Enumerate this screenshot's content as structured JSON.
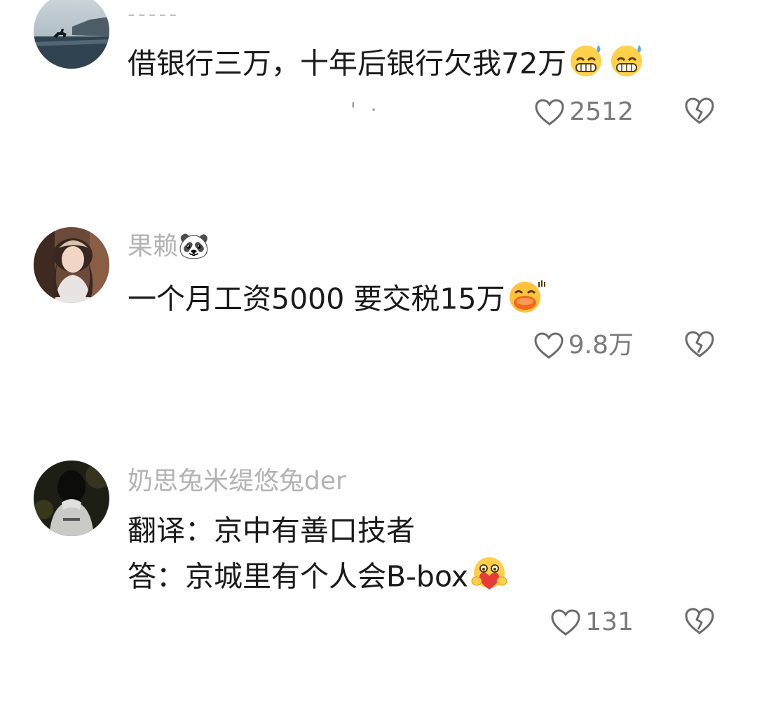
{
  "comments": [
    {
      "username": "-----",
      "avatar_icon": "avatar-horse-rider-beach",
      "lines": [
        "借银行三万，十年后银行欠我72万"
      ],
      "emojis": [
        "grin-sweat-emoji",
        "grin-sweat-emoji"
      ],
      "like_count": "2512",
      "extra_mark": "' ·"
    },
    {
      "username": "果赖🐼",
      "avatar_icon": "avatar-girl-portrait",
      "lines": [
        "一个月工资5000 要交税15万"
      ],
      "emojis": [
        "laughing-blushing-emoji"
      ],
      "like_count": "9.8万"
    },
    {
      "username": "奶思兔米缇悠兔der",
      "avatar_icon": "avatar-hooded-figure-night",
      "lines": [
        "翻译：京中有善口技者",
        "答：京城里有个人会B-box"
      ],
      "emojis": [
        "heart-hug-emoji"
      ],
      "like_count": "131"
    }
  ],
  "icons": {
    "like": "heart-outline-icon",
    "dislike": "broken-heart-icon"
  },
  "colors": {
    "text": "#1a1a1a",
    "username": "#b3b3b3",
    "count": "#7a7a7a",
    "icon": "#6b6b6b"
  }
}
